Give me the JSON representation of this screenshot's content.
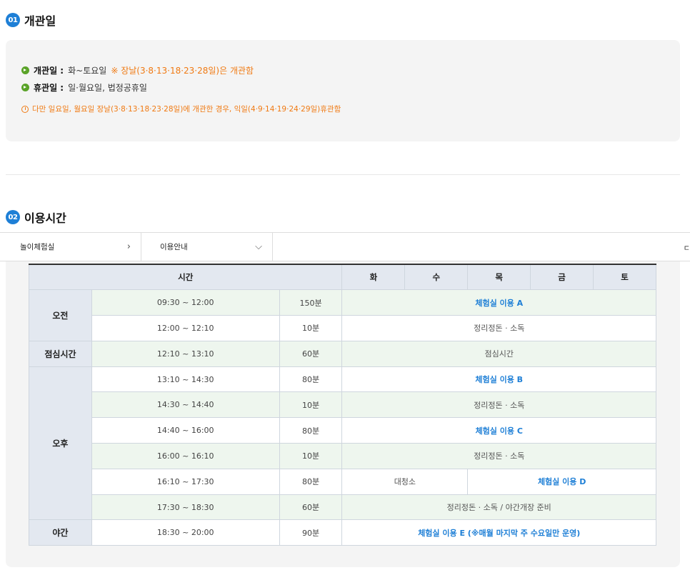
{
  "section1": {
    "number": "01",
    "title": "개관일",
    "open_label": "개관일 :",
    "open_text": "화~토요일",
    "open_note": "※ 장날(3·8·13·18·23·28일)은 개관함",
    "closed_label": "휴관일 :",
    "closed_text": "일·월요일, 법정공휴일",
    "notice": "다만 일요일, 월요일 장날(3·8·13·18·23·28일)에 개관한 경우, 익일(4·9·14·19·24·29일)휴관함"
  },
  "section2": {
    "number": "02",
    "title": "이용시간"
  },
  "breadcrumb": {
    "item1": "놀이체험실",
    "item2": "이용안내",
    "edge": "ㄷ"
  },
  "table": {
    "headers": {
      "time": "시간",
      "days": [
        "화",
        "수",
        "목",
        "금",
        "토"
      ]
    },
    "periods": {
      "am": "오전",
      "lunch": "점심시간",
      "pm": "오후",
      "night": "야간"
    },
    "rows": [
      {
        "time": "09:30 ~ 12:00",
        "minutes": "150분",
        "activity": "체험실 이용 A"
      },
      {
        "time": "12:00 ~ 12:10",
        "minutes": "10분",
        "activity": "정리정돈 · 소독"
      },
      {
        "time": "12:10 ~ 13:10",
        "minutes": "60분",
        "activity": "점심시간"
      },
      {
        "time": "13:10 ~ 14:30",
        "minutes": "80분",
        "activity": "체험실 이용 B"
      },
      {
        "time": "14:30 ~ 14:40",
        "minutes": "10분",
        "activity": "정리정돈 · 소독"
      },
      {
        "time": "14:40 ~ 16:00",
        "minutes": "80분",
        "activity": "체험실 이용 C"
      },
      {
        "time": "16:00 ~ 16:10",
        "minutes": "10분",
        "activity": "정리정돈 · 소독"
      },
      {
        "time": "16:10 ~ 17:30",
        "minutes": "80분",
        "activity_left": "대청소",
        "activity_right": "체험실 이용 D"
      },
      {
        "time": "17:30 ~ 18:30",
        "minutes": "60분",
        "activity": "정리정돈 · 소독 / 야간개장 준비"
      },
      {
        "time": "18:30 ~ 20:00",
        "minutes": "90분",
        "activity": "체험실 이용 E (※매월 마지막 주 수요일만 운영)"
      }
    ]
  },
  "colors": {
    "accent_blue": "#1e7fd6",
    "accent_orange": "#f07a13",
    "bullet_green": "#5aa328",
    "header_bg": "#e3e8f0",
    "row_green": "#eef6ee"
  }
}
